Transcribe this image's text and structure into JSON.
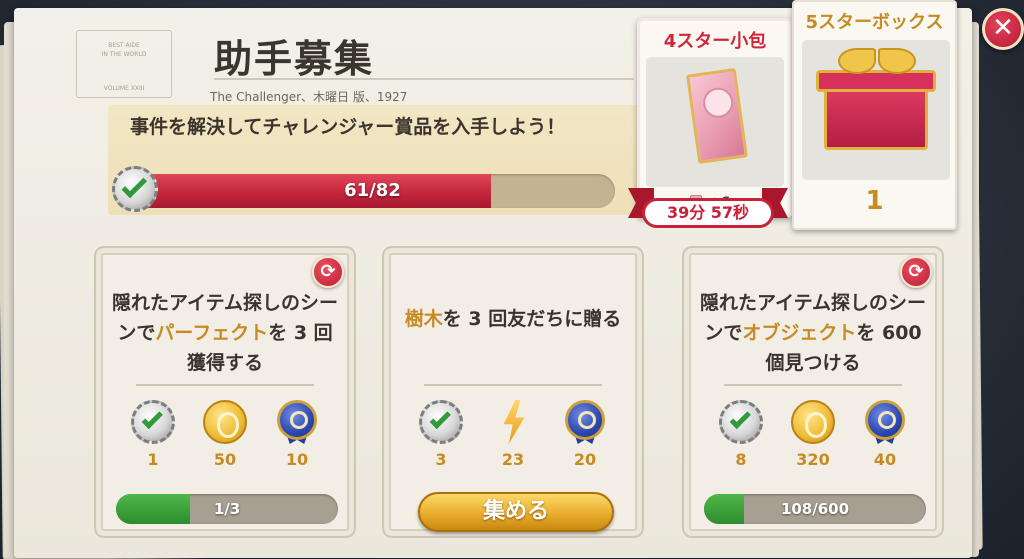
{
  "header": {
    "title": "助手募集",
    "subtitle": "The Challenger、木曜日 版、1927",
    "masthead_line1": "BEST AIDE",
    "masthead_line2": "IN THE WORLD",
    "masthead_bottom": "VOLUME XXIII"
  },
  "challenge": {
    "text": "事件を解決してチャレンジャー賞品を入手しよう！",
    "progress_label": "61/82",
    "progress_current": 61,
    "progress_total": 82,
    "bar_color": "#c2243a"
  },
  "pack": {
    "title": "4スター小包",
    "count": "+1",
    "timer": "39分 57秒"
  },
  "box": {
    "title": "5スターボックス",
    "count": "1"
  },
  "tasks": [
    {
      "text_before": "隠れたアイテム探しのシーンで",
      "highlight": "パーフェクト",
      "text_after": "を 3 回獲得する",
      "rewards": [
        {
          "icon": "check-medal-icon",
          "value": "1"
        },
        {
          "icon": "gold-coin-icon",
          "value": "50"
        },
        {
          "icon": "blue-magnifier-medal-icon",
          "value": "10"
        }
      ],
      "progress_label": "1/3",
      "progress_fraction": 0.333
    },
    {
      "text_before": "",
      "highlight": "樹木",
      "text_after": "を 3 回友だちに贈る",
      "rewards": [
        {
          "icon": "check-medal-icon",
          "value": "3"
        },
        {
          "icon": "energy-bolt-icon",
          "value": "23"
        },
        {
          "icon": "blue-magnifier-medal-icon",
          "value": "20"
        }
      ],
      "button_label": "集める"
    },
    {
      "text_before": "隠れたアイテム探しのシーンで",
      "highlight": "オブジェクト",
      "text_after": "を 600 個見つける",
      "rewards": [
        {
          "icon": "check-medal-icon",
          "value": "8"
        },
        {
          "icon": "gold-coin-icon",
          "value": "320"
        },
        {
          "icon": "blue-magnifier-medal-icon",
          "value": "40"
        }
      ],
      "progress_label": "108/600",
      "progress_fraction": 0.18
    }
  ],
  "colors": {
    "accent_red": "#c8213a",
    "accent_gold": "#c68b24",
    "progress_green": "#2c8d2c"
  }
}
